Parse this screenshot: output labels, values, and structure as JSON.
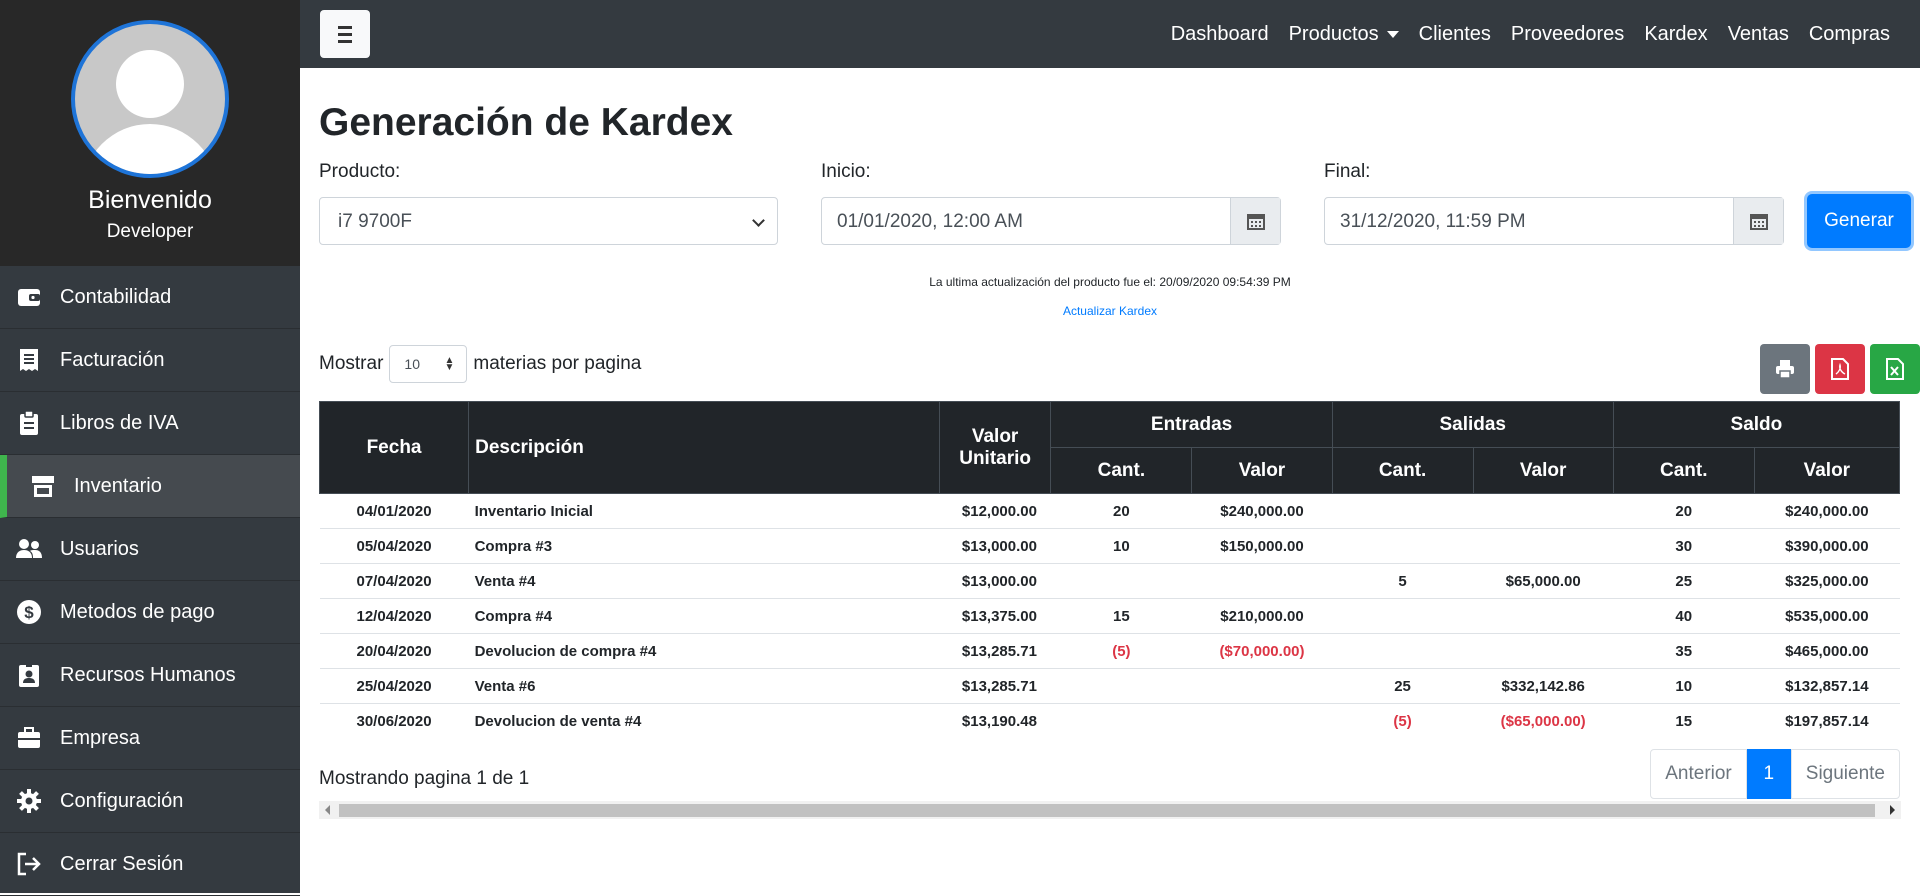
{
  "sidebar": {
    "welcome": "Bienvenido",
    "role": "Developer",
    "items": [
      {
        "label": "Contabilidad",
        "icon": "wallet-icon"
      },
      {
        "label": "Facturación",
        "icon": "receipt-icon"
      },
      {
        "label": "Libros de IVA",
        "icon": "clipboard-icon"
      },
      {
        "label": "Inventario",
        "icon": "store-icon",
        "active": true
      },
      {
        "label": "Usuarios",
        "icon": "users-icon"
      },
      {
        "label": "Metodos de pago",
        "icon": "dollar-icon"
      },
      {
        "label": "Recursos Humanos",
        "icon": "id-badge-icon"
      },
      {
        "label": "Empresa",
        "icon": "briefcase-icon"
      },
      {
        "label": "Configuración",
        "icon": "gear-icon"
      },
      {
        "label": "Cerrar Sesión",
        "icon": "logout-icon"
      }
    ]
  },
  "nav": {
    "dashboard": "Dashboard",
    "productos": "Productos",
    "clientes": "Clientes",
    "proveedores": "Proveedores",
    "kardex": "Kardex",
    "ventas": "Ventas",
    "compras": "Compras"
  },
  "page": {
    "title": "Generación de Kardex",
    "product_label": "Producto:",
    "product_value": "i7 9700F",
    "start_label": "Inicio:",
    "start_value": "01/01/2020, 12:00 AM",
    "end_label": "Final:",
    "end_value": "31/12/2020, 11:59 PM",
    "generate": "Generar",
    "update_note": "La ultima actualización del producto fue el: 20/09/2020 09:54:39 PM",
    "update_link": "Actualizar Kardex",
    "show_prefix": "Mostrar",
    "per_page": "10",
    "show_suffix": "materias por pagina"
  },
  "table": {
    "headers": {
      "fecha": "Fecha",
      "descripcion": "Descripción",
      "valor_unitario": "Valor Unitario",
      "entradas": "Entradas",
      "salidas": "Salidas",
      "saldo": "Saldo",
      "cant": "Cant.",
      "valor": "Valor"
    },
    "rows": [
      {
        "fecha": "04/01/2020",
        "desc": "Inventario Inicial",
        "unit": "$12,000.00",
        "ent_cant": "20",
        "ent_val": "$240,000.00",
        "sal_cant": "",
        "sal_val": "",
        "sdo_cant": "20",
        "sdo_val": "$240,000.00"
      },
      {
        "fecha": "05/04/2020",
        "desc": "Compra #3",
        "unit": "$13,000.00",
        "ent_cant": "10",
        "ent_val": "$150,000.00",
        "sal_cant": "",
        "sal_val": "",
        "sdo_cant": "30",
        "sdo_val": "$390,000.00"
      },
      {
        "fecha": "07/04/2020",
        "desc": "Venta #4",
        "unit": "$13,000.00",
        "ent_cant": "",
        "ent_val": "",
        "sal_cant": "5",
        "sal_val": "$65,000.00",
        "sdo_cant": "25",
        "sdo_val": "$325,000.00"
      },
      {
        "fecha": "12/04/2020",
        "desc": "Compra #4",
        "unit": "$13,375.00",
        "ent_cant": "15",
        "ent_val": "$210,000.00",
        "sal_cant": "",
        "sal_val": "",
        "sdo_cant": "40",
        "sdo_val": "$535,000.00"
      },
      {
        "fecha": "20/04/2020",
        "desc": "Devolucion de compra #4",
        "unit": "$13,285.71",
        "ent_cant": "(5)",
        "ent_val": "($70,000.00)",
        "sal_cant": "",
        "sal_val": "",
        "sdo_cant": "35",
        "sdo_val": "$465,000.00"
      },
      {
        "fecha": "25/04/2020",
        "desc": "Venta #6",
        "unit": "$13,285.71",
        "ent_cant": "",
        "ent_val": "",
        "sal_cant": "25",
        "sal_val": "$332,142.86",
        "sdo_cant": "10",
        "sdo_val": "$132,857.14"
      },
      {
        "fecha": "30/06/2020",
        "desc": "Devolucion de venta #4",
        "unit": "$13,190.48",
        "ent_cant": "",
        "ent_val": "",
        "sal_cant": "(5)",
        "sal_val": "($65,000.00)",
        "sdo_cant": "15",
        "sdo_val": "$197,857.14"
      }
    ]
  },
  "pagination": {
    "info": "Mostrando pagina 1 de 1",
    "prev": "Anterior",
    "current": "1",
    "next": "Siguiente"
  },
  "colors": {
    "primary": "#007bff",
    "danger": "#dc3545",
    "success": "#28a745",
    "secondary": "#6c757d",
    "active_accent": "#3fb54d"
  }
}
